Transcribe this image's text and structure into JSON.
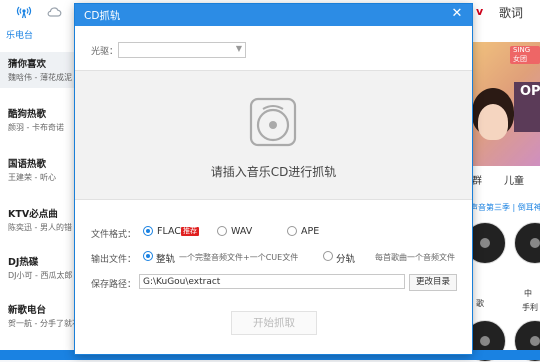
{
  "background": {
    "top": {
      "right_char": "v",
      "lyrics_tab": "歌词"
    },
    "sidebar": {
      "section_label": "乐电台",
      "radios": [
        {
          "title": "猜你喜欢",
          "subtitle": "魏晗伟 - 薄花成泥"
        },
        {
          "title": "酷狗热歌",
          "subtitle": "颜羽 - 卡布奇诺"
        },
        {
          "title": "国语热歌",
          "subtitle": "王建荣 - 听心"
        },
        {
          "title": "KTV必点曲",
          "subtitle": "陈奕迅 - 男人的错"
        },
        {
          "title": "DJ热碟",
          "subtitle": "DJ小可 - 西瓜太郎"
        },
        {
          "title": "新歌电台",
          "subtitle": "贺一航 - 分手了就不必问"
        }
      ]
    },
    "right_panel": {
      "banner_tag": "SING女团",
      "banner_text": "OP",
      "tabs": [
        "群",
        "儿童"
      ],
      "link_text": "声音第三季 | 倒耳神器",
      "disc_labels": [
        "歌",
        "中",
        "手利"
      ]
    },
    "colors": {
      "accent": "#1a82e2",
      "badge": "#e02020"
    }
  },
  "dialog": {
    "title": "CD抓轨",
    "close_icon": "close-icon",
    "drive": {
      "label": "光驱：",
      "value": ""
    },
    "message": "请插入音乐CD进行抓轨",
    "format": {
      "label": "文件格式：",
      "options": [
        {
          "label": "FLAC",
          "badge": "推荐",
          "checked": true
        },
        {
          "label": "WAV",
          "checked": false
        },
        {
          "label": "APE",
          "checked": false
        }
      ]
    },
    "output": {
      "label": "输出文件：",
      "options": [
        {
          "label": "整轨",
          "note": "一个完整音频文件+一个CUE文件",
          "checked": true
        },
        {
          "label": "分轨",
          "note": "每首歌曲一个音频文件",
          "checked": false
        }
      ]
    },
    "save_path": {
      "label": "保存路径：",
      "value": "G:\\KuGou\\extract",
      "change_button": "更改目录"
    },
    "start_button": "开始抓取"
  }
}
